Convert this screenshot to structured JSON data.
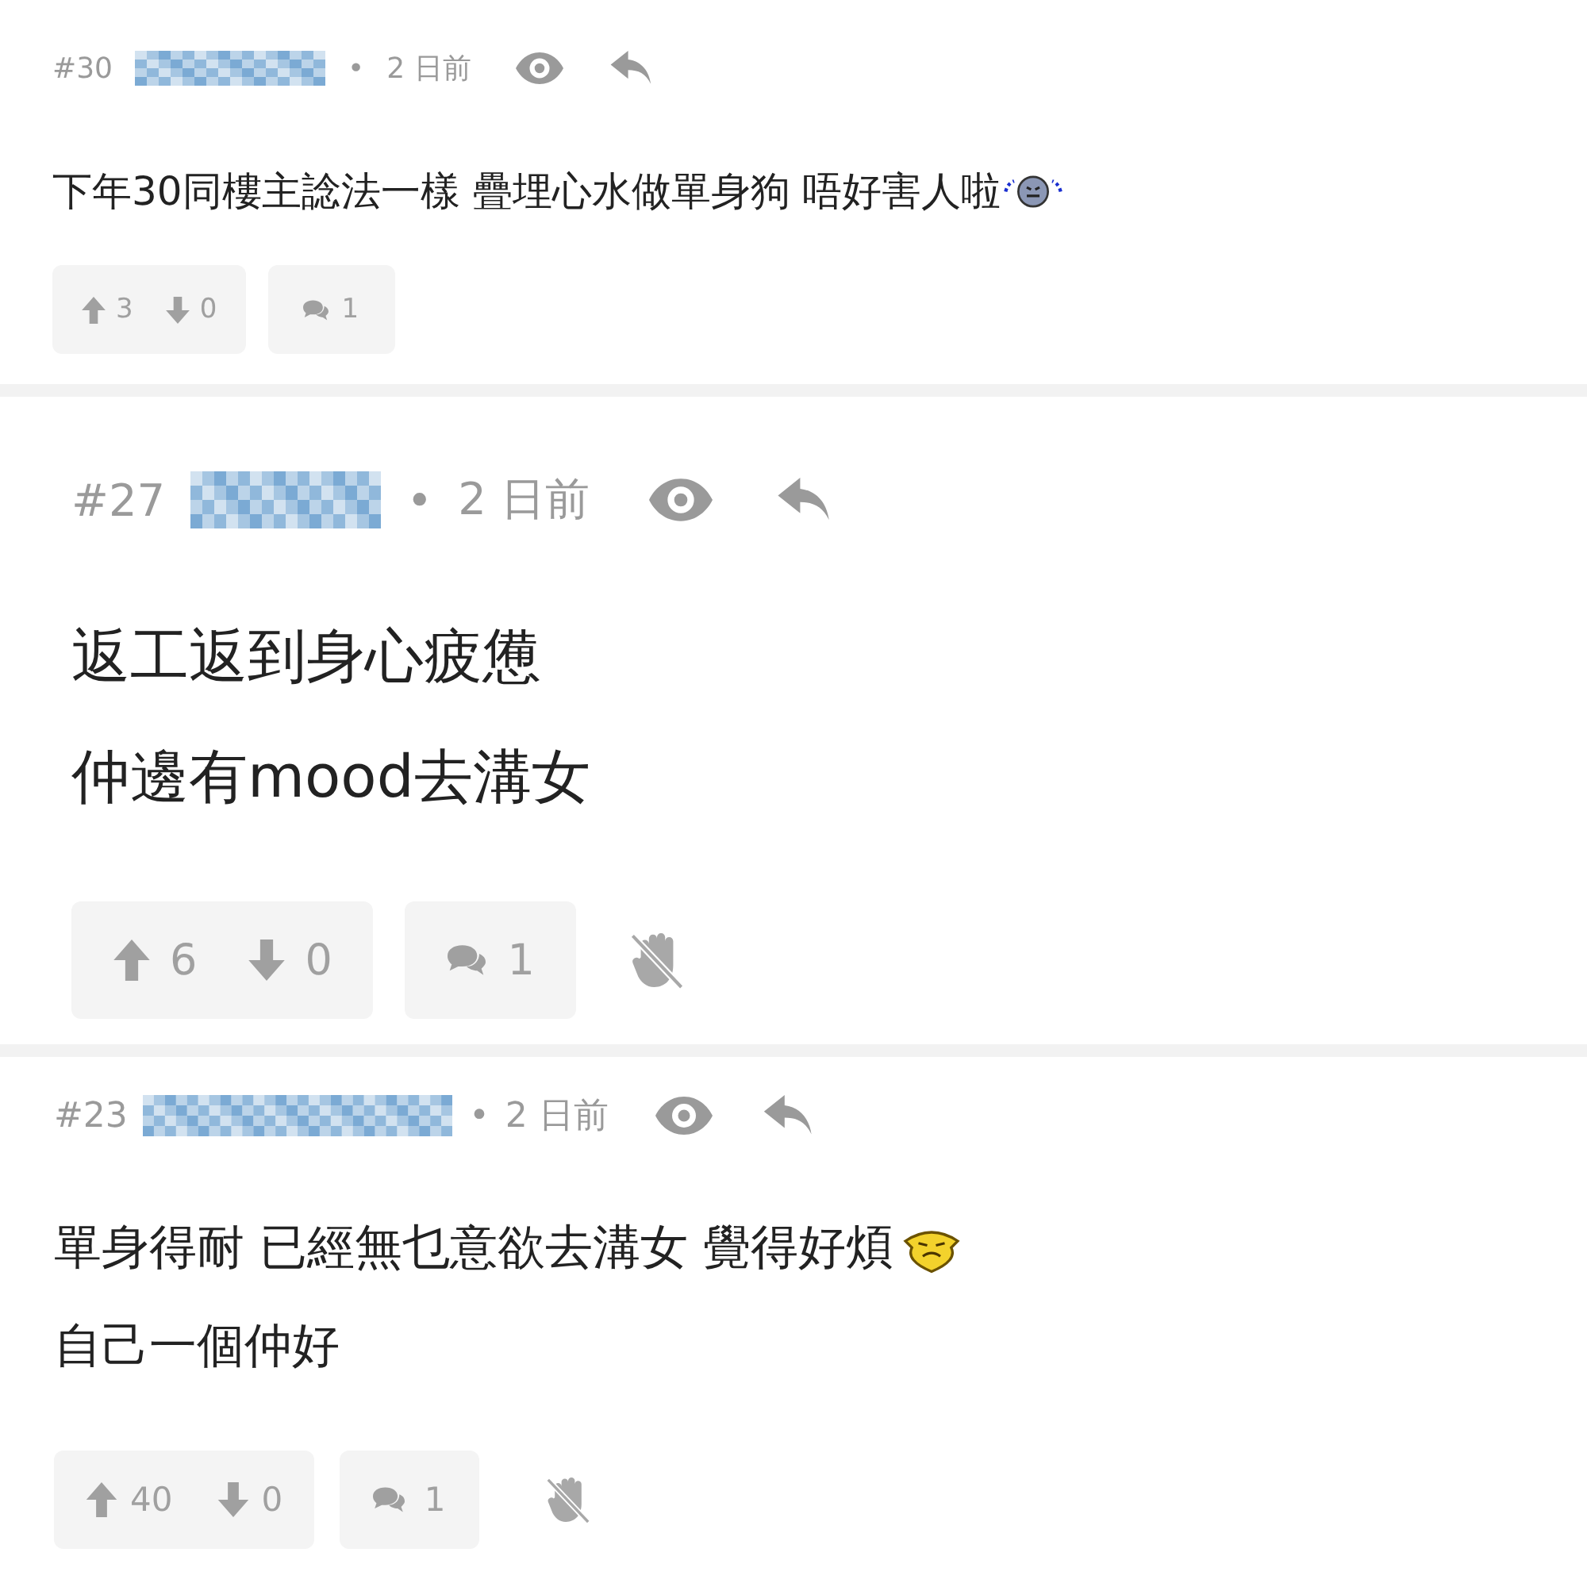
{
  "posts": [
    {
      "number": "#30",
      "separator": "•",
      "time": "2 日前",
      "lines": [
        {
          "kind": "crying",
          "text": "下年30同樓主諗法一樣 疊埋心水做單身狗 唔好害人啦"
        }
      ],
      "upvotes": "3",
      "downvotes": "0",
      "replies": "1",
      "report": false
    },
    {
      "number": "#27",
      "separator": "•",
      "time": "2 日前",
      "lines": [
        {
          "kind": "plain",
          "text": "返工返到身心疲憊"
        },
        {
          "kind": "plain",
          "text": "仲邊有mood去溝女"
        }
      ],
      "upvotes": "6",
      "downvotes": "0",
      "replies": "1",
      "report": true
    },
    {
      "number": "#23",
      "separator": "•",
      "time": "2 日前",
      "lines": [
        {
          "kind": "annoyed",
          "text": "單身得耐 已經無乜意欲去溝女 覺得好煩"
        },
        {
          "kind": "plain",
          "text": "自己一個仲好"
        }
      ],
      "upvotes": "40",
      "downvotes": "0",
      "replies": "1",
      "report": true
    }
  ]
}
